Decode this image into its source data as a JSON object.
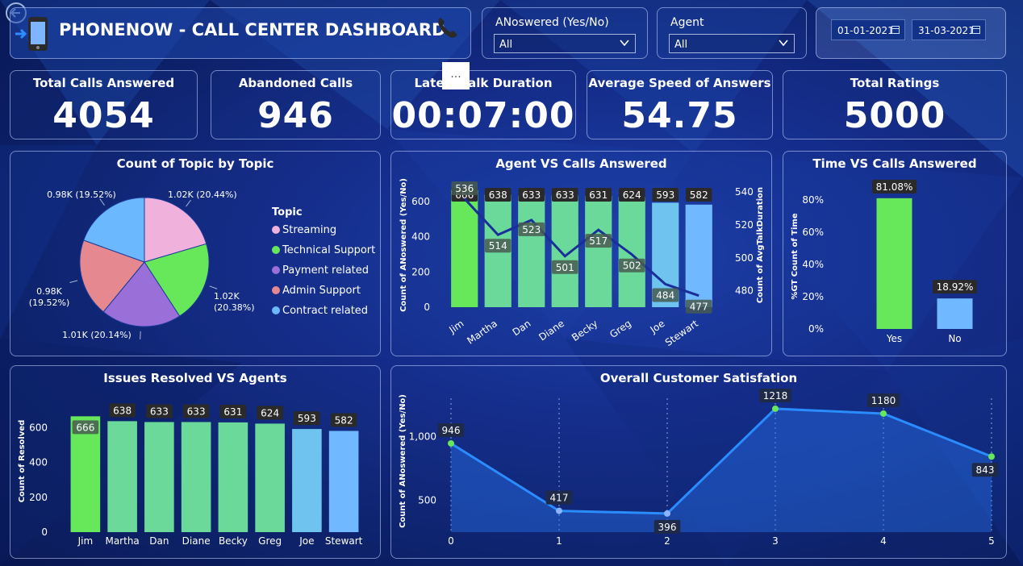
{
  "header": {
    "title": "PHONENOW - CALL CENTER DASHBOARD",
    "app_icon": "mobile-phone-icon",
    "phone_icon": "telephone-receiver-icon",
    "back_icon": "back-arrow-icon"
  },
  "filters": {
    "answered": {
      "label": "ANoswered (Yes/No)",
      "value": "All"
    },
    "agent": {
      "label": "Agent",
      "value": "All"
    },
    "date_start": "01-01-2021",
    "date_end": "31-03-2021"
  },
  "more_options_label": "...",
  "kpis": [
    {
      "label": "Total Calls Answered",
      "value": "4054"
    },
    {
      "label": "Abandoned Calls",
      "value": "946"
    },
    {
      "label": "Latest Talk Duration",
      "value": "00:07:00"
    },
    {
      "label": "Average Speed of Answers",
      "value": "54.75"
    },
    {
      "label": "Total Ratings",
      "value": "5000"
    }
  ],
  "colors": {
    "green_bright": "#66e85a",
    "green_light": "#6bd99a",
    "blue_light": "#6ec3ef",
    "blue": "#70b8ff",
    "line": "#1a2e9a",
    "satisfaction_line": "#2a8cff",
    "pink": "#f0b2dc",
    "purple": "#9a70d8",
    "salmon": "#e5888f",
    "sky": "#6bb8ff"
  },
  "chart_data": [
    {
      "id": "topic",
      "type": "pie",
      "title": "Count of Topic by Topic",
      "legend_title": "Topic",
      "legend_position": "right",
      "slices": [
        {
          "name": "Streaming",
          "value": 1.02,
          "percent": 20.44,
          "label": "1.02K (20.44%)",
          "color": "#f0b2dc"
        },
        {
          "name": "Technical Support",
          "value": 1.02,
          "percent": 20.38,
          "label": "1.02K (20.38%)",
          "color": "#66e85a"
        },
        {
          "name": "Payment related",
          "value": 1.01,
          "percent": 20.14,
          "label": "1.01K (20.14%)",
          "color": "#9a70d8"
        },
        {
          "name": "Admin Support",
          "value": 0.98,
          "percent": 19.52,
          "label": "0.98K (19.52%)",
          "color": "#e5888f"
        },
        {
          "name": "Contract related",
          "value": 0.98,
          "percent": 19.52,
          "label": "0.98K (19.52%)",
          "color": "#6bb8ff"
        }
      ]
    },
    {
      "id": "agent_calls",
      "type": "bar",
      "title": "Agent VS Calls Answered",
      "categories": [
        "Jim",
        "Martha",
        "Dan",
        "Diane",
        "Becky",
        "Greg",
        "Joe",
        "Stewart"
      ],
      "series": [
        {
          "values": [
            666,
            638,
            633,
            633,
            631,
            624,
            593,
            582
          ]
        },
        {
          "values": [
            536,
            514,
            523,
            501,
            517,
            502,
            484,
            477
          ],
          "axis": "right"
        }
      ],
      "ylabel": "Count of ANoswered (Yes/No)",
      "y2label": "Count of AvgTalkDuration",
      "ylim": [
        0,
        700
      ],
      "y_ticks": [
        "0",
        "200",
        "400",
        "600"
      ],
      "y2lim": [
        470,
        545
      ],
      "y2_ticks": [
        "480",
        "500",
        "520",
        "540"
      ],
      "bar_colors": [
        "#66e85a",
        "#6bd99a",
        "#6bd99a",
        "#6bd99a",
        "#6bd99a",
        "#6bd99a",
        "#6ec3ef",
        "#70b8ff"
      ]
    },
    {
      "id": "time_calls",
      "type": "bar",
      "title": "Time VS Calls Answered",
      "categories": [
        "Yes",
        "No"
      ],
      "values": [
        81.08,
        18.92
      ],
      "labels": [
        "81.08%",
        "18.92%"
      ],
      "ylabel": "%GT Count of Time",
      "ylim": [
        0,
        90
      ],
      "y_ticks": [
        "0%",
        "20%",
        "40%",
        "60%",
        "80%"
      ],
      "bar_colors": [
        "#66e85a",
        "#70b8ff"
      ]
    },
    {
      "id": "issues_resolved",
      "type": "bar",
      "title": "Issues Resolved VS Agents",
      "categories": [
        "Jim",
        "Martha",
        "Dan",
        "Diane",
        "Becky",
        "Greg",
        "Joe",
        "Stewart"
      ],
      "values": [
        666,
        638,
        633,
        633,
        631,
        624,
        593,
        582
      ],
      "ylabel": "Count of Resolved",
      "ylim": [
        0,
        700
      ],
      "y_ticks": [
        "0",
        "200",
        "400",
        "600"
      ],
      "bar_colors": [
        "#66e85a",
        "#6bd99a",
        "#6bd99a",
        "#6bd99a",
        "#6bd99a",
        "#6bd99a",
        "#6ec3ef",
        "#70b8ff"
      ]
    },
    {
      "id": "satisfaction",
      "type": "area",
      "title": "Overall Customer Satisfation",
      "x": [
        0,
        1,
        2,
        3,
        4,
        5
      ],
      "x_ticks": [
        "0",
        "1",
        "2",
        "3",
        "4",
        "5"
      ],
      "values": [
        946,
        417,
        396,
        1218,
        1180,
        843
      ],
      "ylabel": "Count of ANoswered (Yes/No)",
      "ylim": [
        250,
        1300
      ],
      "y_ticks": [
        "500",
        "1,000"
      ],
      "y_tick_values": [
        500,
        1000
      ]
    }
  ]
}
